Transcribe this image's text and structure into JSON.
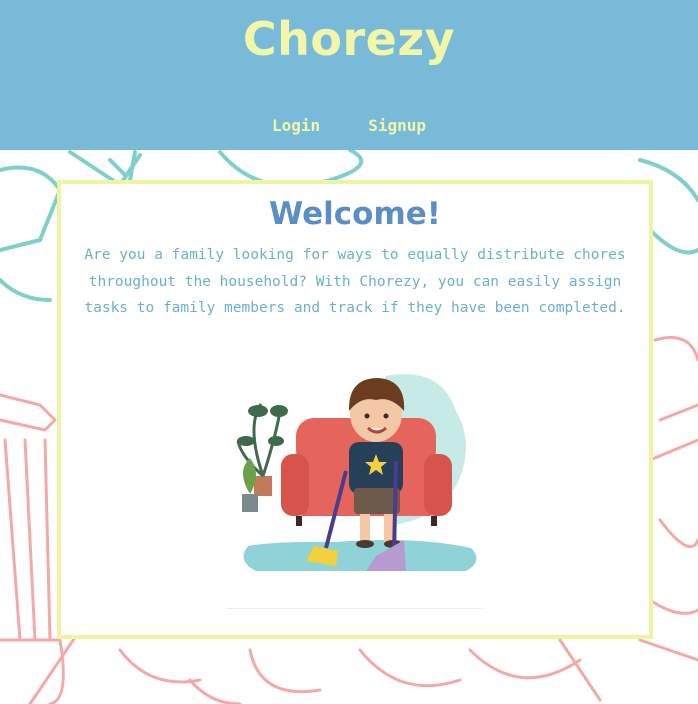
{
  "header": {
    "brand": "Chorezy",
    "nav": {
      "login_label": "Login",
      "signup_label": "Signup"
    }
  },
  "main": {
    "title": "Welcome!",
    "intro": "Are you a family looking for ways to equally distribute chores throughout the household? With Chorezy, you can easily assign tasks to family members and track if they have been completed.",
    "illustration": "boy-sweeping-illustration"
  },
  "background": {
    "pattern": "household-chores-doodles"
  },
  "colors": {
    "header_bg": "#79bad8",
    "brand_text": "#f2f6a8",
    "card_border": "#eef4a4",
    "title": "#5a8ec4",
    "intro_text": "#6ab0cf",
    "doodle_teal": "#7fcfca",
    "doodle_pink": "#f3aaa6"
  }
}
